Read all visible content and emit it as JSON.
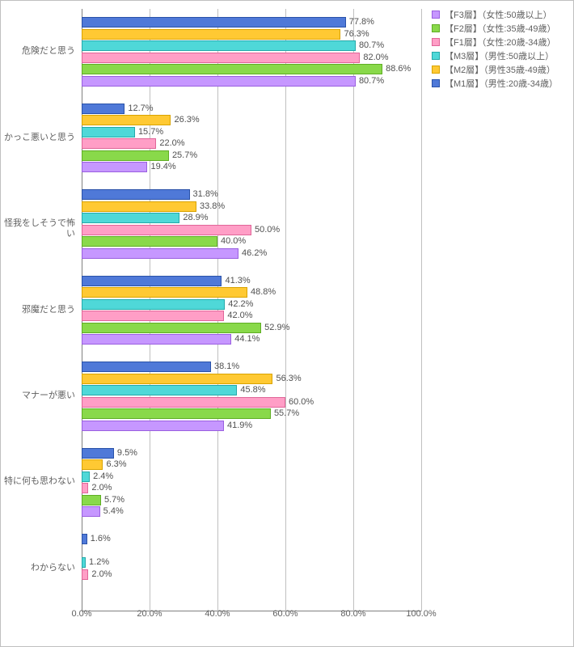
{
  "chart_data": {
    "type": "bar",
    "orientation": "horizontal",
    "xlabel": "",
    "ylabel": "",
    "xlim": [
      0,
      100
    ],
    "x_ticks": [
      0,
      20,
      40,
      60,
      80,
      100
    ],
    "x_tick_labels": [
      "0.0%",
      "20.0%",
      "40.0%",
      "60.0%",
      "80.0%",
      "100.0%"
    ],
    "categories": [
      "危険だと思う",
      "かっこ悪いと思う",
      "怪我をしそうで怖い",
      "邪魔だと思う",
      "マナーが悪い",
      "特に何も思わない",
      "わからない"
    ],
    "series": [
      {
        "key": "M1",
        "name": "【M1層】（男性:20歳-34歳）",
        "color": "#4f79d8",
        "values": [
          77.8,
          12.7,
          31.8,
          41.3,
          38.1,
          9.5,
          1.6
        ]
      },
      {
        "key": "M2",
        "name": "【M2層】（男性35歳-49歳）",
        "color": "#ffc933",
        "values": [
          76.3,
          26.3,
          33.8,
          48.8,
          56.3,
          6.3,
          null
        ]
      },
      {
        "key": "M3",
        "name": "【M3層】（男性:50歳以上）",
        "color": "#4fd8d8",
        "values": [
          80.7,
          15.7,
          28.9,
          42.2,
          45.8,
          2.4,
          1.2
        ]
      },
      {
        "key": "F1",
        "name": "【F1層】（女性:20歳-34歳）",
        "color": "#ff9ec6",
        "values": [
          82.0,
          22.0,
          50.0,
          42.0,
          60.0,
          2.0,
          2.0
        ]
      },
      {
        "key": "F2",
        "name": "【F2層】（女性:35歳-49歳）",
        "color": "#89d94a",
        "values": [
          88.6,
          25.7,
          40.0,
          52.9,
          55.7,
          5.7,
          null
        ]
      },
      {
        "key": "F3",
        "name": "【F3層】（女性:50歳以上）",
        "color": "#c697ff",
        "values": [
          80.7,
          19.4,
          46.2,
          44.1,
          41.9,
          5.4,
          null
        ]
      }
    ],
    "legend_order": [
      "F3",
      "F2",
      "F1",
      "M3",
      "M2",
      "M1"
    ],
    "bar_draw_order": [
      "M1",
      "M2",
      "M3",
      "F1",
      "F2",
      "F3"
    ]
  }
}
